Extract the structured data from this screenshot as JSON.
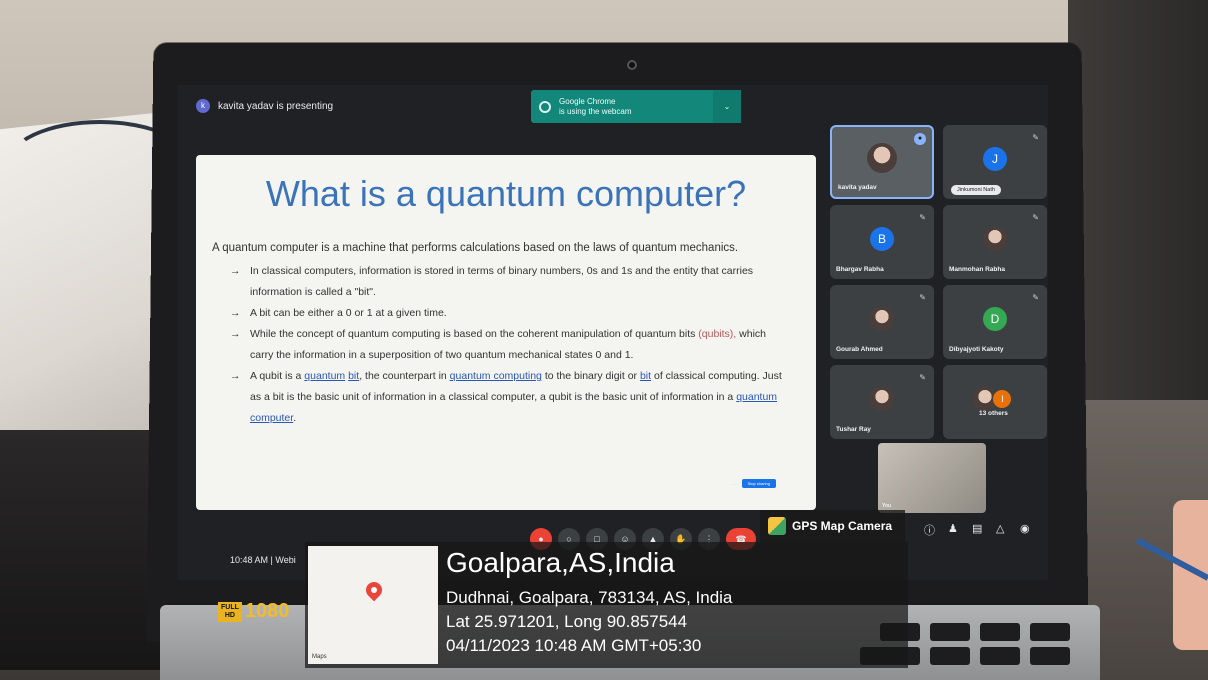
{
  "meet": {
    "presenter_text": "kavita yadav is presenting",
    "presenter_initial": "k",
    "chrome_banner": {
      "line1": "Google Chrome",
      "line2": "is using the webcam"
    },
    "clock": "10:48 AM",
    "clock_separator": "|",
    "meeting_code_partial": "Webi"
  },
  "slide": {
    "title": "What is a quantum computer?",
    "intro": "A quantum computer is a machine that performs calculations based on the laws of quantum mechanics.",
    "bullet1": "In classical computers, information is stored in terms of binary numbers, 0s and 1s and the entity that carries information is called  a \"bit\".",
    "bullet2": "A bit can be either a  0 or 1 at a given time.",
    "bullet3_pre": "While the concept of quantum computing is based on the coherent manipulation of quantum bits",
    "bullet3_qubits": "(qubits),",
    "bullet3_post": "which carry the information in a superposition of two quantum mechanical states 0 and 1.",
    "bullet4": {
      "t1": "A qubit is a",
      "l1": "quantum",
      "l2": "bit",
      "t2": ", the counterpart in",
      "l3": "quantum computing",
      "t3": "to the binary digit or",
      "l4": "bit",
      "t4": "of classical computing. Just as a bit is the basic unit of information in a classical computer, a qubit is the basic unit of information in a",
      "l5": "quantum computer",
      "t5": "."
    },
    "stop_button": "Stop sharing"
  },
  "participants": [
    {
      "name": "kavita yadav",
      "self_view": true
    },
    {
      "name": "Jinkumoni Nath",
      "initial": "J",
      "color": "#1a73e8"
    },
    {
      "name": "Bhargav Rabha",
      "initial": "B",
      "color": "#1a73e8"
    },
    {
      "name": "Manmohan Rabha"
    },
    {
      "name": "Gourab Ahmed"
    },
    {
      "name": "Dibyajyoti Kakoty",
      "initial": "D",
      "color": "#34a853"
    },
    {
      "name": "Tushar Ray"
    },
    {
      "name": "13 others",
      "initial": "I",
      "color": "#e8710a"
    }
  ],
  "you_label": "You",
  "geotag": {
    "app_name": "GPS Map Camera",
    "maps_label": "Maps",
    "city": "Goalpara,AS,India",
    "address": "Dudhnai, Goalpara, 783134, AS, India",
    "coords": "Lat 25.971201, Long 90.857544",
    "timestamp": "04/11/2023 10:48 AM GMT+05:30"
  },
  "hd_badge": {
    "line1": "FULL",
    "line2": "HD",
    "resolution": "1080"
  }
}
